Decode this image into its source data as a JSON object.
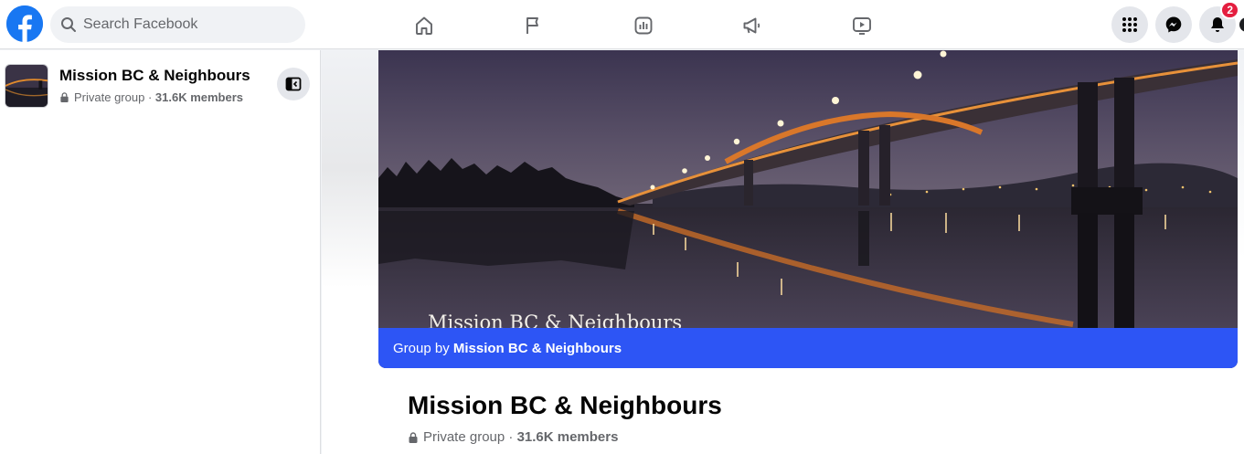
{
  "topbar": {
    "search_placeholder": "Search Facebook",
    "nav_icons": [
      "home-icon",
      "pages-flag-icon",
      "groups-chart-icon",
      "ads-megaphone-icon",
      "watch-video-icon"
    ],
    "right_buttons": [
      "menu-grid-icon",
      "messenger-icon",
      "notifications-bell-icon"
    ],
    "notification_count": "2"
  },
  "sidebar": {
    "group_name": "Mission BC & Neighbours",
    "privacy": "Private group",
    "separator": " · ",
    "members": "31.6K members"
  },
  "cover": {
    "caption": "Mission BC & Neighbours",
    "byline_prefix": "Group by ",
    "byline_name": "Mission BC & Neighbours"
  },
  "header": {
    "group_name": "Mission BC & Neighbours",
    "privacy": "Private group",
    "separator": " · ",
    "members": "31.6K members"
  },
  "colors": {
    "brand_blue": "#1877f2",
    "cover_bar": "#2d55f5",
    "badge_red": "#e41e3f"
  }
}
